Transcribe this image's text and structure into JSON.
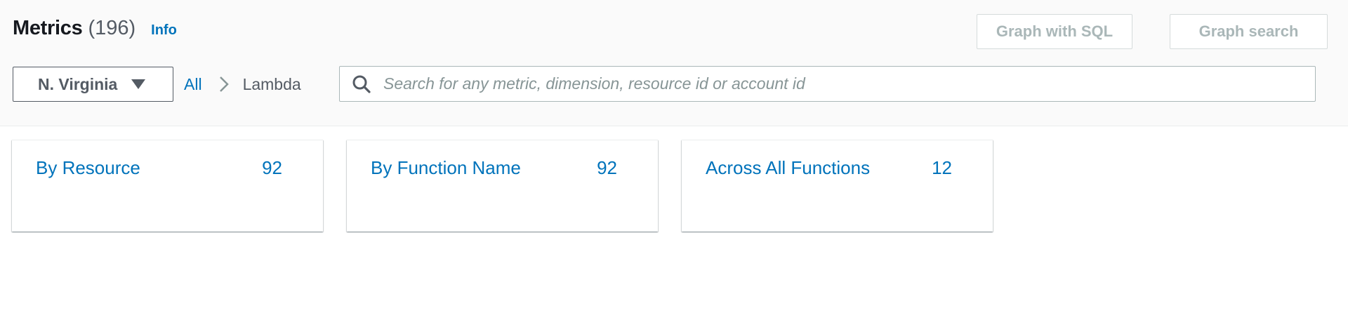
{
  "header": {
    "title": "Metrics",
    "count": "(196)",
    "info_label": "Info",
    "graph_with_sql_label": "Graph with SQL",
    "graph_search_label": "Graph search"
  },
  "region": {
    "selected": "N. Virginia"
  },
  "breadcrumb": {
    "items": [
      {
        "label": "All",
        "link": true
      },
      {
        "label": "Lambda",
        "link": false
      }
    ]
  },
  "search": {
    "placeholder": "Search for any metric, dimension, resource id or account id",
    "value": ""
  },
  "cards": [
    {
      "label": "By Resource",
      "count": "92"
    },
    {
      "label": "By Function Name",
      "count": "92"
    },
    {
      "label": "Across All Functions",
      "count": "12"
    }
  ],
  "colors": {
    "link": "#0073bb",
    "text": "#16191f",
    "muted": "#545b64",
    "disabled": "#aab7b8",
    "header_bg": "#fafafa"
  }
}
